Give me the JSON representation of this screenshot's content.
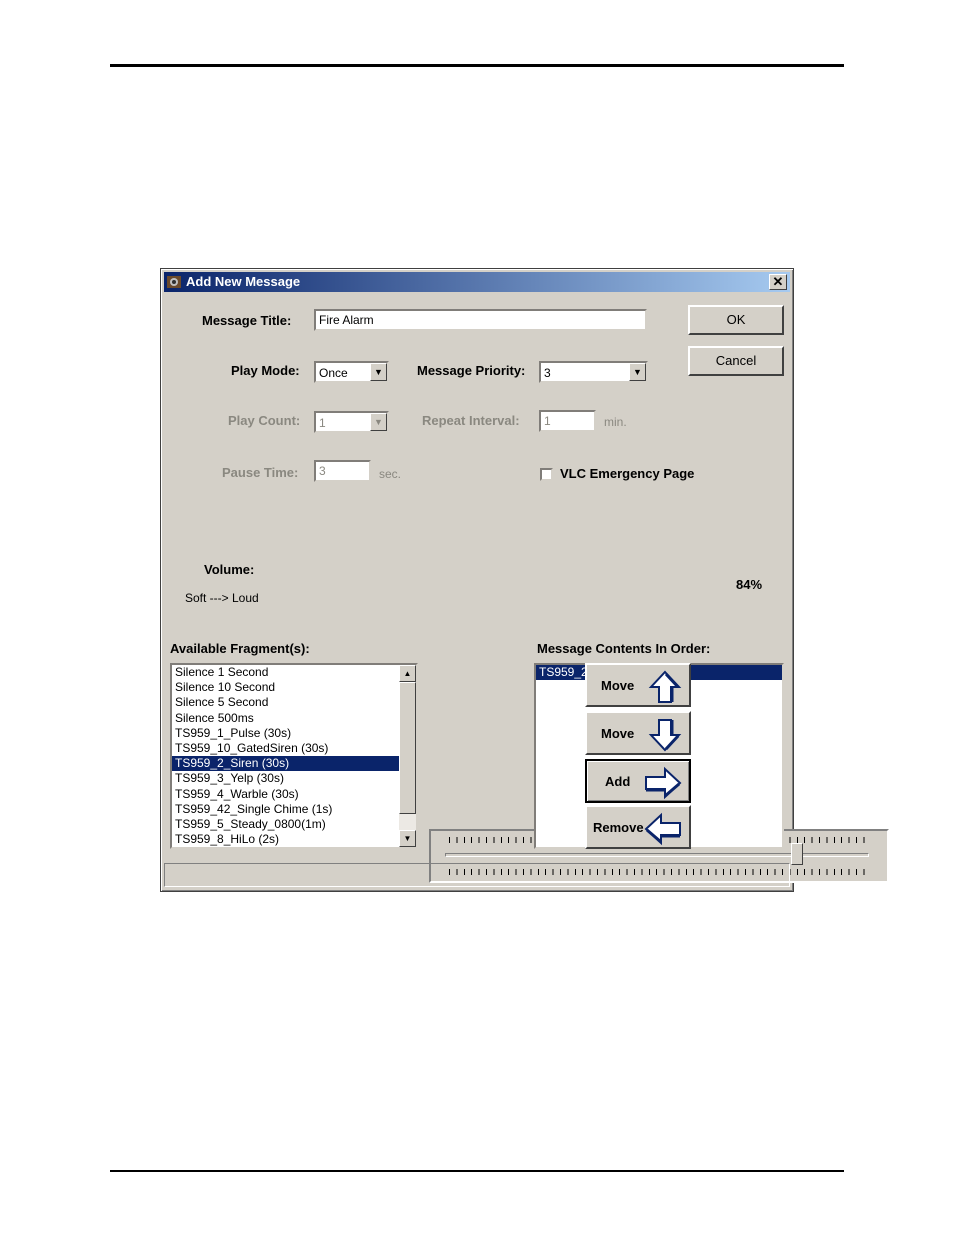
{
  "dialog": {
    "title": "Add New Message",
    "close_label": "✕"
  },
  "message_title": {
    "label": "Message Title:",
    "value": "Fire Alarm"
  },
  "buttons": {
    "ok": "OK",
    "cancel": "Cancel"
  },
  "play_mode": {
    "label": "Play Mode:",
    "value": "Once"
  },
  "priority": {
    "label": "Message Priority:",
    "value": "3"
  },
  "play_count": {
    "label": "Play Count:",
    "value": "1"
  },
  "repeat_interval": {
    "label": "Repeat Interval:",
    "value": "1",
    "unit": "min."
  },
  "pause_time": {
    "label": "Pause Time:",
    "value": "3",
    "unit": "sec."
  },
  "vlc_emergency": {
    "label": "VLC Emergency Page",
    "checked": false
  },
  "volume": {
    "label": "Volume:",
    "sublabel": "Soft ---> Loud",
    "value_text": "84%",
    "level": 0.84
  },
  "available": {
    "label": "Available Fragment(s):",
    "items": [
      "Silence 1 Second",
      "Silence 10 Second",
      "Silence 5 Second",
      "Silence 500ms",
      "TS959_1_Pulse (30s)",
      "TS959_10_GatedSiren (30s)",
      "TS959_2_Siren (30s)",
      "TS959_3_Yelp (30s)",
      "TS959_4_Warble (30s)",
      "TS959_42_Single Chime (1s)",
      "TS959_5_Steady_0800(1m)",
      "TS959_8_HiLo (2s)"
    ],
    "selected_index": 6
  },
  "contents": {
    "label": "Message Contents In Order:",
    "items": [
      "TS959_2_Siren (30s)"
    ],
    "selected_index": 0
  },
  "actions": {
    "move_up": "Move",
    "move_down": "Move",
    "add": "Add",
    "remove": "Remove"
  }
}
